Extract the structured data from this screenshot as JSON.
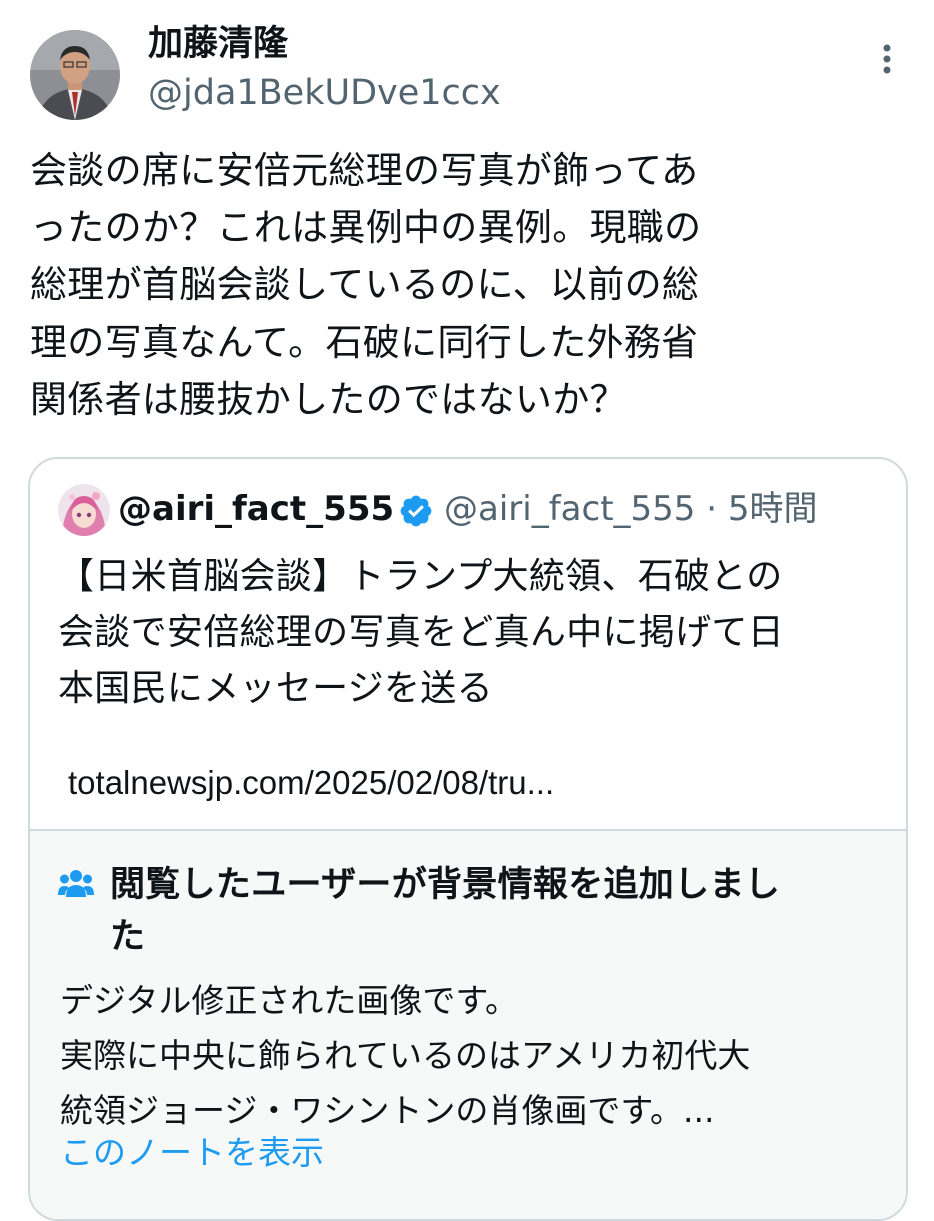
{
  "author": {
    "display_name": "加藤清隆",
    "handle": "@jda1BekUDve1ccx",
    "avatar_icon": "profile-photo"
  },
  "more_icon": "more-vertical-icon",
  "tweet": {
    "lines": [
      "会談の席に安倍元総理の写真が飾ってあ",
      "ったのか？これは異例中の異例。現職の",
      "総理が首脳会談しているのに、以前の総",
      "理の写真なんて。石破に同行した外務省",
      "関係者は腰抜かしたのではないか？"
    ]
  },
  "quote": {
    "display_name": "@airi_fact_555",
    "handle": "@airi_fact_555",
    "separator": "·",
    "time": "5時間",
    "verified_icon": "verified-badge-icon",
    "text_lines": [
      "【日米首脳会談】トランプ大統領、石破との",
      "会談で安倍総理の写真をど真ん中に掲げて日",
      "本国民にメッセージを送る"
    ],
    "link": "totalnewsjp.com/2025/02/08/tru..."
  },
  "note": {
    "icon": "people-icon",
    "header_lines": [
      "閲覧したユーザーが背景情報を追加しまし",
      "た"
    ],
    "body_lines": [
      "デジタル修正された画像です。",
      "実際に中央に飾られているのはアメリカ初代大",
      "統領ジョージ・ワシントンの肖像画です。..."
    ],
    "show_note_label": "このノートを表示"
  },
  "colors": {
    "text": "#0f1419",
    "secondary": "#536471",
    "border": "#cfd9de",
    "note_background": "#f7f9f9",
    "accent": "#1d9bf0"
  }
}
